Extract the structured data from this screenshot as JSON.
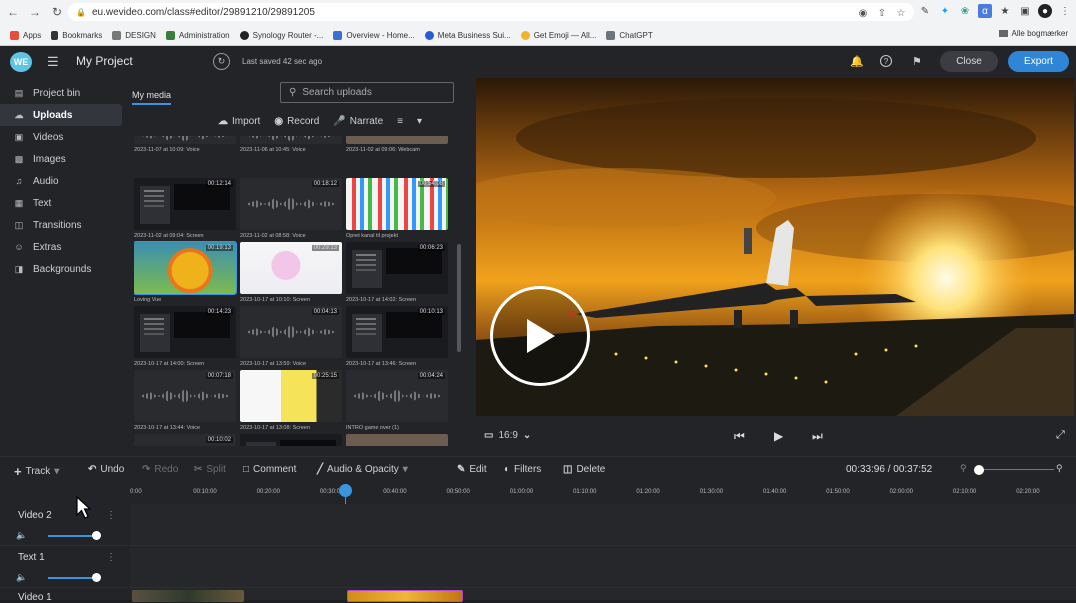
{
  "browser": {
    "url": "eu.wevideo.com/class#editor/29891210/29891205",
    "bookmarks": [
      "Apps",
      "Bookmarks",
      "DESIGN",
      "Administration",
      "Synology Router -...",
      "Overview - Home...",
      "Meta Business Sui...",
      "Get Emoji — All...",
      "ChatGPT"
    ],
    "other_bookmarks": "Alle bogmærker"
  },
  "app": {
    "logo": "WE",
    "project_title": "My Project",
    "saved_status": "Last saved 42 sec ago",
    "close_label": "Close",
    "export_label": "Export",
    "accent": "#2f86d6"
  },
  "sidebar": {
    "items": [
      {
        "label": "Project bin",
        "icon": "folder-icon"
      },
      {
        "label": "Uploads",
        "icon": "upload-icon",
        "active": true
      },
      {
        "label": "Videos",
        "icon": "video-icon"
      },
      {
        "label": "Images",
        "icon": "image-icon"
      },
      {
        "label": "Audio",
        "icon": "music-icon"
      },
      {
        "label": "Text",
        "icon": "text-icon"
      },
      {
        "label": "Transitions",
        "icon": "transition-icon"
      },
      {
        "label": "Extras",
        "icon": "smiley-icon"
      },
      {
        "label": "Backgrounds",
        "icon": "backgrounds-icon"
      }
    ]
  },
  "media": {
    "tab_label": "My media",
    "search_placeholder": "Search uploads",
    "import_label": "Import",
    "record_label": "Record",
    "narrate_label": "Narrate",
    "items": [
      {
        "kind": "wave",
        "label": "2023-11-07 at 10:09: Voice",
        "duration": ""
      },
      {
        "kind": "wave",
        "label": "2023-11-06 at 10:45: Voice",
        "duration": ""
      },
      {
        "kind": "pic",
        "label": "2023-11-02 at 09:06: Webcam",
        "duration": ""
      },
      {
        "kind": "screen",
        "label": "2023-11-02 at 09:04: Screen",
        "duration": "00:12:14"
      },
      {
        "kind": "wave",
        "label": "2023-11-02 at 08:58: Voice",
        "duration": "00:18:12"
      },
      {
        "kind": "icons",
        "label": "Opret kanal til projekt",
        "duration": "00:54:08"
      },
      {
        "kind": "bird",
        "label": "Loving Vue",
        "duration": "00:19:13"
      },
      {
        "kind": "pink",
        "label": "2023-10-17 at 10:10: Screen",
        "duration": "00:29:13"
      },
      {
        "kind": "screen",
        "label": "2023-10-17 at 14:02: Screen",
        "duration": "00:06:23"
      },
      {
        "kind": "screen",
        "label": "2023-10-17 at 14:00: Screen",
        "duration": "00:14:23"
      },
      {
        "kind": "wave",
        "label": "2023-10-17 at 13:59: Voice",
        "duration": "00:04:13"
      },
      {
        "kind": "screen",
        "label": "2023-10-17 at 13:46: Screen",
        "duration": "00:10:13"
      },
      {
        "kind": "wave",
        "label": "2023-10-17 at 13:44: Voice",
        "duration": "00:07:18"
      },
      {
        "kind": "yellow",
        "label": "2023-10-17 at 13:08: Screen",
        "duration": "00:25:15"
      },
      {
        "kind": "wave",
        "label": "INTRO game over (1)",
        "duration": "00:04:24"
      },
      {
        "kind": "wave",
        "label": "",
        "duration": "00:10:02"
      },
      {
        "kind": "screen",
        "label": "",
        "duration": ""
      },
      {
        "kind": "pic",
        "label": "",
        "duration": ""
      }
    ]
  },
  "preview": {
    "aspect_ratio": "16:9"
  },
  "toolbar": {
    "track": "Track",
    "undo": "Undo",
    "redo": "Redo",
    "split": "Split",
    "comment": "Comment",
    "audio_opacity": "Audio & Opacity",
    "edit": "Edit",
    "filters": "Filters",
    "delete": "Delete",
    "timecode": "00:33:96 / 00:37:52"
  },
  "timeline": {
    "ticks": [
      "0:00",
      "00:10:00",
      "00:20:00",
      "00:30:00",
      "00:40:00",
      "00:50:00",
      "01:00:00",
      "01:10:00",
      "01:20:00",
      "01:30:00",
      "01:40:00",
      "01:50:00",
      "02:00:00",
      "02:10:00",
      "02:20:00"
    ],
    "tracks": [
      {
        "name": "Video 2"
      },
      {
        "name": "Text 1"
      },
      {
        "name": "Video 1"
      }
    ]
  }
}
